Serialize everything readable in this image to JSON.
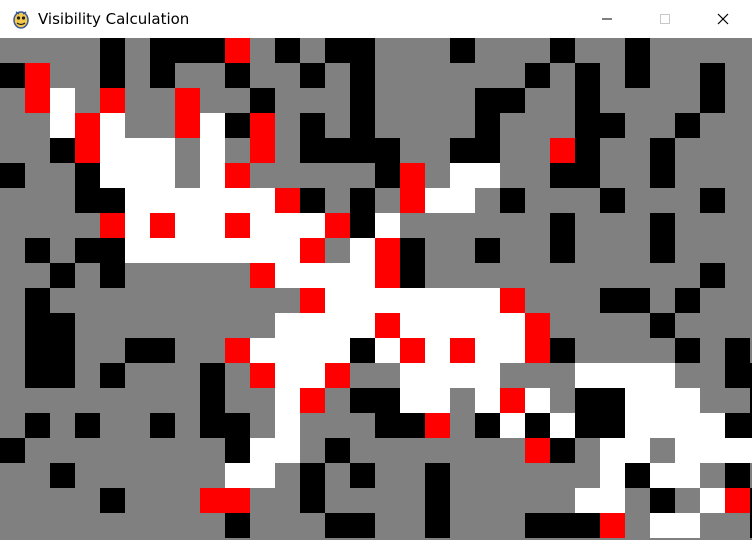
{
  "window": {
    "title": "Visibility Calculation",
    "app_icon": "pygame-snake-icon",
    "controls": [
      {
        "name": "minimize-button",
        "icon": "minimize-icon"
      },
      {
        "name": "maximize-button",
        "icon": "maximize-icon"
      },
      {
        "name": "close-button",
        "icon": "close-icon"
      }
    ]
  },
  "legend_colors": {
    "#": "#000000",
    ".": "#808080",
    "w": "#ffffff",
    "r": "#ff0000"
  },
  "grid": {
    "columns": 30,
    "rows": 20,
    "cells": [
      "....#.###r.#.##...#...#..#...",
      "#r..#.#..#..#.#......#.#.#..#.",
      ".rw.r..r..#...#....##..#....#.",
      "..wrw..rw#r.#.#....#...##..#..",
      "..#rwww.w.r.####..##..r#..#...",
      "#..#www.wr.....#r.ww..##..#...",
      "...##wwwwwwr#.#.rww.#...#...#.",
      "....rwrwwrwwwr#w......#...#...",
      ".#.##wwwwwwwr.wr#..#..#...#...",
      "..#.#.....rwwwwr#...........#.",
      ".#..........rwwwwwwwr...##.#..",
      ".##........wwwwrwwwwwr....#...",
      ".##..##..rwwww#wrwrwwr#....#.#",
      ".##.#...#.rwwr..wwww...wwww..##",
      "........#..wr.##ww.wrw.##www..#",
      ".#.#..#.##.w...##r.#w#w##wwww##",
      "#........#ww.#.......r#.ww.wwwwr",
      "..#......ww.#.#..#......w#ww.#..",
      "....#...rr..#....#.....ww.#.wr#.",
      ".........#...##..#...###r.ww..#."
    ]
  }
}
